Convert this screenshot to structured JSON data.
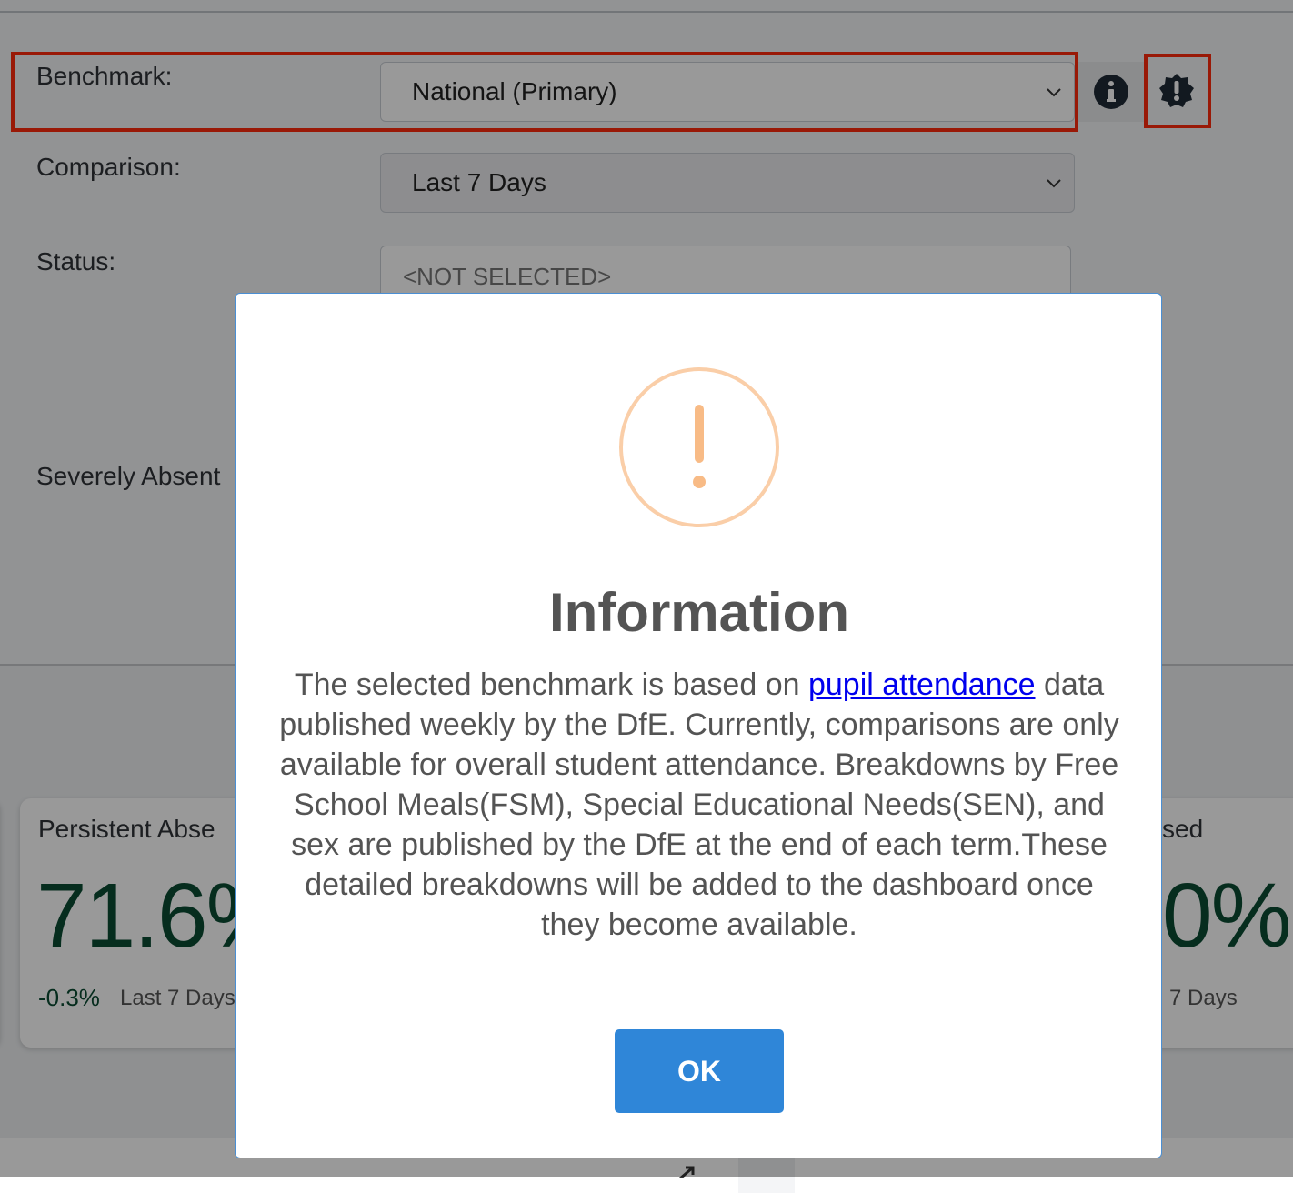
{
  "filters": {
    "benchmark": {
      "label": "Benchmark:",
      "value": "National (Primary)"
    },
    "comparison": {
      "label": "Comparison:",
      "value": "Last 7 Days"
    },
    "status": {
      "label": "Status:",
      "placeholder": "<NOT SELECTED>"
    },
    "severely_absent": {
      "label": "Severely Absent"
    }
  },
  "icons": {
    "info": "info-circle-icon",
    "alert": "alert-badge-icon",
    "chevron": "chevron-down-icon",
    "warning": "exclamation-circle-icon"
  },
  "cards": {
    "persistent": {
      "title": "Persistent Abse",
      "value": "71.6%",
      "delta": "-0.3%",
      "comparison": "Last 7 Days"
    },
    "right": {
      "title": "sed",
      "value": "0%",
      "comparison": "7 Days"
    }
  },
  "modal": {
    "title": "Information",
    "body_prefix": "The selected benchmark is based on ",
    "link_text": "pupil attendance",
    "body_suffix": " data published weekly by the DfE. Currently, comparisons are only available for overall student attendance. Breakdowns by Free School Meals(FSM), Special Educational Needs(SEN), and sex are published by the DfE at the end of each term.These detailed breakdowns will be added to the dashboard once they become available.",
    "ok_label": "OK"
  },
  "colors": {
    "accent": "#2f86d8",
    "kpi_green": "#0b4b33",
    "warning_orange": "#f8bb86",
    "highlight_red": "#ff2a0d"
  }
}
